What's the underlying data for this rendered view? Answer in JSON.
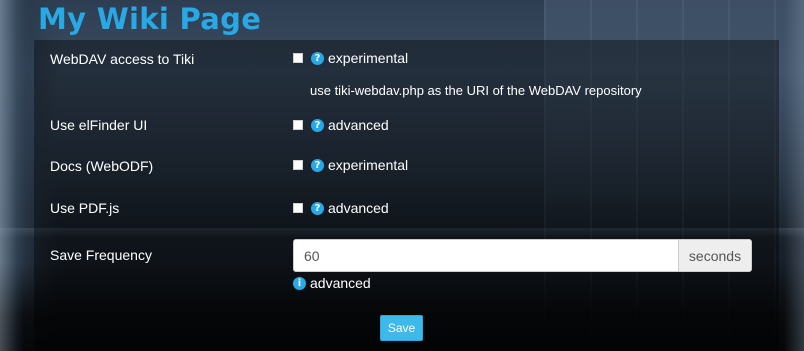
{
  "page": {
    "title": "My Wiki Page"
  },
  "settings": [
    {
      "label": "WebDAV access to Tiki",
      "tag": "experimental",
      "hint": "use tiki-webdav.php as the URI of the WebDAV repository"
    },
    {
      "label": "Use elFinder UI",
      "tag": "advanced"
    },
    {
      "label": "Docs (WebODF)",
      "tag": "experimental"
    },
    {
      "label": "Use PDF.js",
      "tag": "advanced"
    }
  ],
  "save_frequency": {
    "label": "Save Frequency",
    "value": "60",
    "unit": "seconds",
    "tag": "advanced"
  },
  "actions": {
    "save_label": "Save"
  },
  "icons": {
    "help": "question-circle-icon",
    "info": "info-circle-icon"
  },
  "colors": {
    "title": "#29a8e6",
    "icon": "#29a8e6",
    "button": "#3db9ec"
  }
}
